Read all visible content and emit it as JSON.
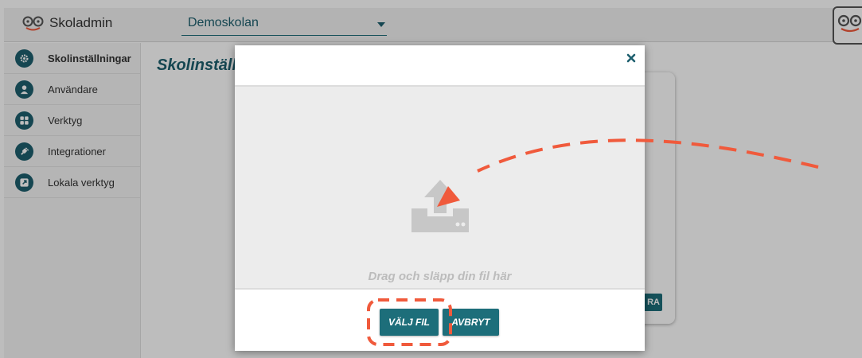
{
  "app": {
    "name": "Skoladmin"
  },
  "header": {
    "school": "Demoskolan"
  },
  "sidebar": {
    "items": [
      {
        "label": "Skolinställningar",
        "icon": "gear-icon",
        "active": true
      },
      {
        "label": "Användare",
        "icon": "user-icon",
        "active": false
      },
      {
        "label": "Verktyg",
        "icon": "grid-icon",
        "active": false
      },
      {
        "label": "Integrationer",
        "icon": "plug-icon",
        "active": false
      },
      {
        "label": "Lokala verktyg",
        "icon": "external-link-icon",
        "active": false
      }
    ]
  },
  "main": {
    "title": "Skolinställn",
    "card_button_label": "ra"
  },
  "modal": {
    "dropzone_text": "Drag och släpp din fil här",
    "choose_file_label": "VÄLJ FIL",
    "cancel_label": "AVBRYT"
  },
  "colors": {
    "accent": "#1d6e7a",
    "annotation": "#f05a3c",
    "overlay": "rgba(0,0,0,0.26)"
  }
}
